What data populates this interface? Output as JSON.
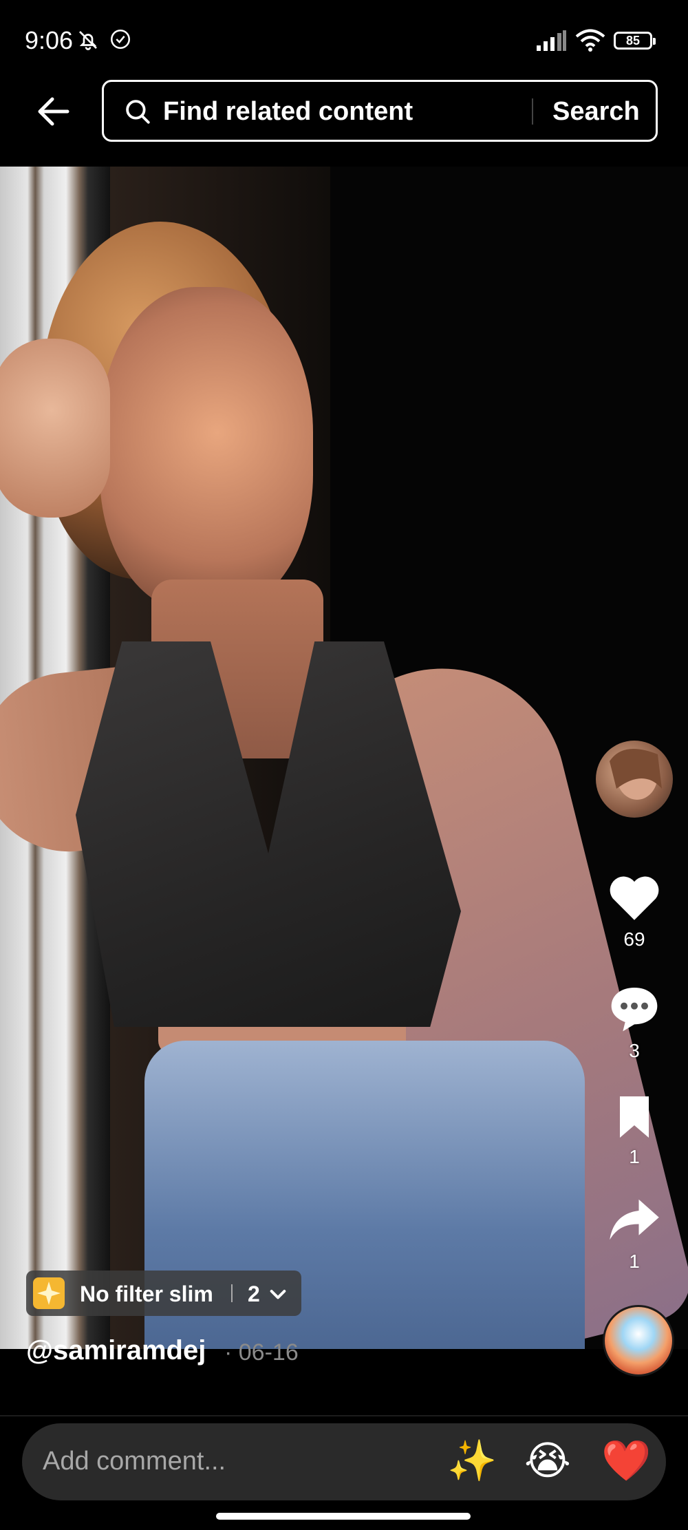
{
  "status_bar": {
    "time": "9:06",
    "battery": "85",
    "icons": [
      "mute-bell-icon",
      "check-circle-icon",
      "signal-icon",
      "wifi-icon",
      "battery-icon"
    ]
  },
  "top_bar": {
    "search_placeholder": "Find related content",
    "search_button": "Search"
  },
  "actions": {
    "likes": "69",
    "comments": "3",
    "favorites": "1",
    "shares": "1"
  },
  "effect": {
    "label": "No filter slim",
    "count": "2"
  },
  "caption": {
    "username": "@samiramdej",
    "date": "· 06-16"
  },
  "comment_bar": {
    "placeholder": "Add comment...",
    "emojis": [
      "✨",
      "😭",
      "❤️"
    ]
  },
  "colors": {
    "background": "#000000",
    "input_bg": "#2a2a2a",
    "muted_text": "#8a8a8a"
  }
}
